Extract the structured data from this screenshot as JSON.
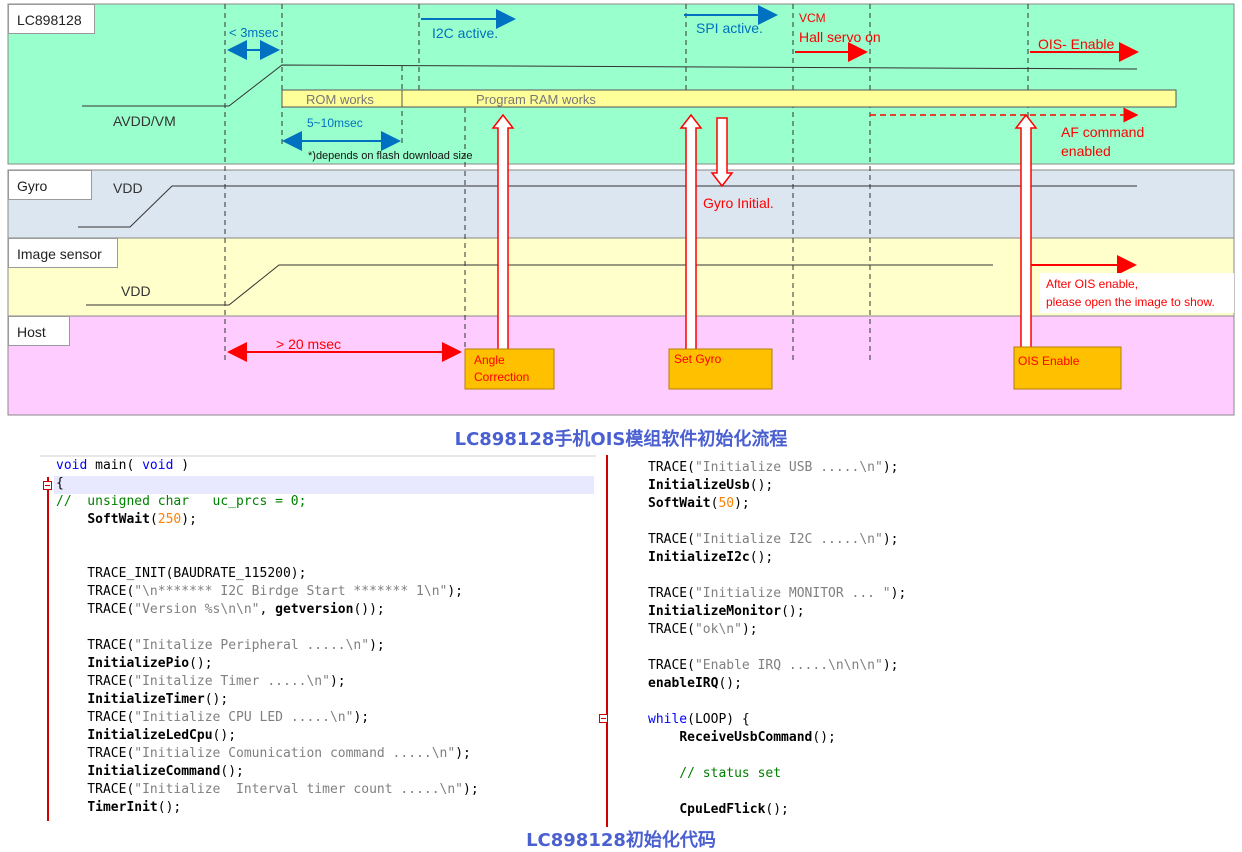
{
  "timing": {
    "lanes": {
      "lc": "LC898128",
      "gyro": "Gyro",
      "image_sensor": "Image sensor",
      "host": "Host"
    },
    "labels": {
      "lt3": "< 3msec",
      "i2c_active": "I2C active.",
      "spi_active": "SPI active.",
      "vcm": "VCM",
      "hall_servo": "Hall servo on",
      "ois_enable_top": "OIS- Enable",
      "rom_works": "ROM works",
      "program_ram": "Program RAM works",
      "avdd": "AVDD/VM",
      "ms_5_10": "5~10msec",
      "flash_note": "*)depends on flash download size",
      "af_command_1": "AF command",
      "af_command_2": "enabled",
      "gyro_vdd": "VDD",
      "gyro_initial": "Gyro Initial.",
      "is_vdd": "VDD",
      "after_ois_1": "After OIS enable,",
      "after_ois_2": "please open the image to show.",
      "gt20": "> 20 msec",
      "angle_1": "Angle",
      "angle_2": "Correction",
      "set_gyro": "Set Gyro",
      "ois_enable_box": "OIS Enable"
    },
    "colors": {
      "lc_bg": "#99ffcc",
      "gyro_bg": "#dce6f0",
      "is_bg": "#ffffcc",
      "host_bg": "#ffccff",
      "box_fill": "#ffc000",
      "blue": "#0070c0",
      "red": "#ff0000",
      "bar_fill": "#ffff99"
    }
  },
  "captions": {
    "flow": "LC898128手机OIS模组软件初始化流程",
    "code": "LC898128初始化代码"
  },
  "code_left": [
    "void main( void )",
    "{",
    "//  unsigned char   uc_prcs = 0;",
    "    SoftWait(250);",
    "",
    "",
    "    TRACE_INIT(BAUDRATE_115200);",
    "    TRACE(\"\\n******* I2C Birdge Start ******* 1\\n\");",
    "    TRACE(\"Version %s\\n\\n\", getversion());",
    "",
    "    TRACE(\"Initalize Peripheral .....\\n\");",
    "    InitializePio();",
    "    TRACE(\"Initalize Timer .....\\n\");",
    "    InitializeTimer();",
    "    TRACE(\"Initialize CPU LED .....\\n\");",
    "    InitializeLedCpu();",
    "    TRACE(\"Initialize Comunication command .....\\n\");",
    "    InitializeCommand();",
    "    TRACE(\"Initialize  Interval timer count .....\\n\");",
    "    TimerInit();"
  ],
  "code_right": [
    "TRACE(\"Initialize USB .....\\n\");",
    "InitializeUsb();",
    "SoftWait(50);",
    "",
    "TRACE(\"Initialize I2C .....\\n\");",
    "InitializeI2c();",
    "",
    "TRACE(\"Initialize MONITOR ... \");",
    "InitializeMonitor();",
    "TRACE(\"ok\\n\");",
    "",
    "TRACE(\"Enable IRQ .....\\n\\n\\n\");",
    "enableIRQ();",
    "",
    "while(LOOP) {",
    "    ReceiveUsbCommand();",
    "",
    "    // status set",
    "",
    "    CpuLedFlick();"
  ]
}
